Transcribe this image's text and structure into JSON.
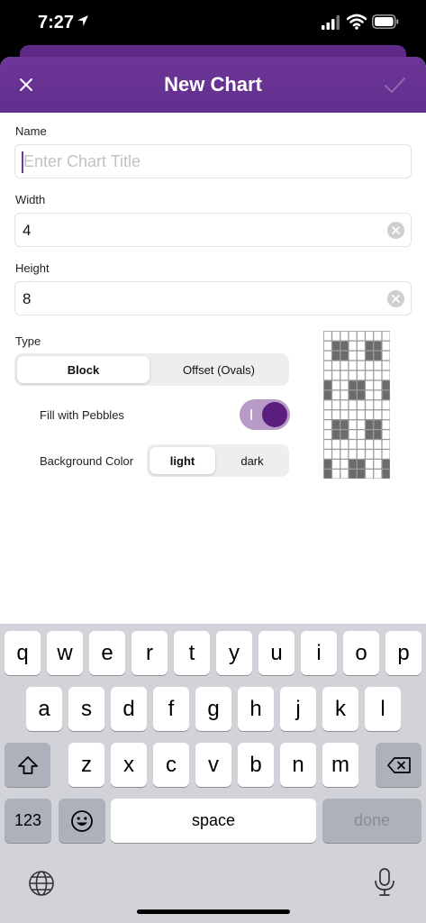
{
  "status": {
    "time": "7:27"
  },
  "nav": {
    "title": "New Chart"
  },
  "form": {
    "name_label": "Name",
    "name_placeholder": "Enter Chart Title",
    "width_label": "Width",
    "width_value": "4",
    "height_label": "Height",
    "height_value": "8",
    "type_label": "Type",
    "type_options": [
      "Block",
      "Offset (Ovals)"
    ],
    "type_selected": "Block",
    "fill_label": "Fill with Pebbles",
    "fill_enabled": true,
    "bg_label": "Background Color",
    "bg_options": [
      "light",
      "dark"
    ],
    "bg_selected": "light"
  },
  "preview": {
    "columns": 8,
    "rows": 15,
    "filled_color": "#6b6b6b",
    "empty_color": "#ffffff",
    "grid_color": "#9a9a9a"
  },
  "keyboard": {
    "row1": [
      "q",
      "w",
      "e",
      "r",
      "t",
      "y",
      "u",
      "i",
      "o",
      "p"
    ],
    "row2": [
      "a",
      "s",
      "d",
      "f",
      "g",
      "h",
      "j",
      "k",
      "l"
    ],
    "row3": [
      "z",
      "x",
      "c",
      "v",
      "b",
      "n",
      "m"
    ],
    "numbers_label": "123",
    "space_label": "space",
    "done_label": "done",
    "icons": [
      "shift-icon",
      "backspace-icon",
      "emoji-icon",
      "globe-icon",
      "microphone-icon"
    ]
  },
  "colors": {
    "accent": "#662f92",
    "toggle_on": "#5a1e7f"
  }
}
